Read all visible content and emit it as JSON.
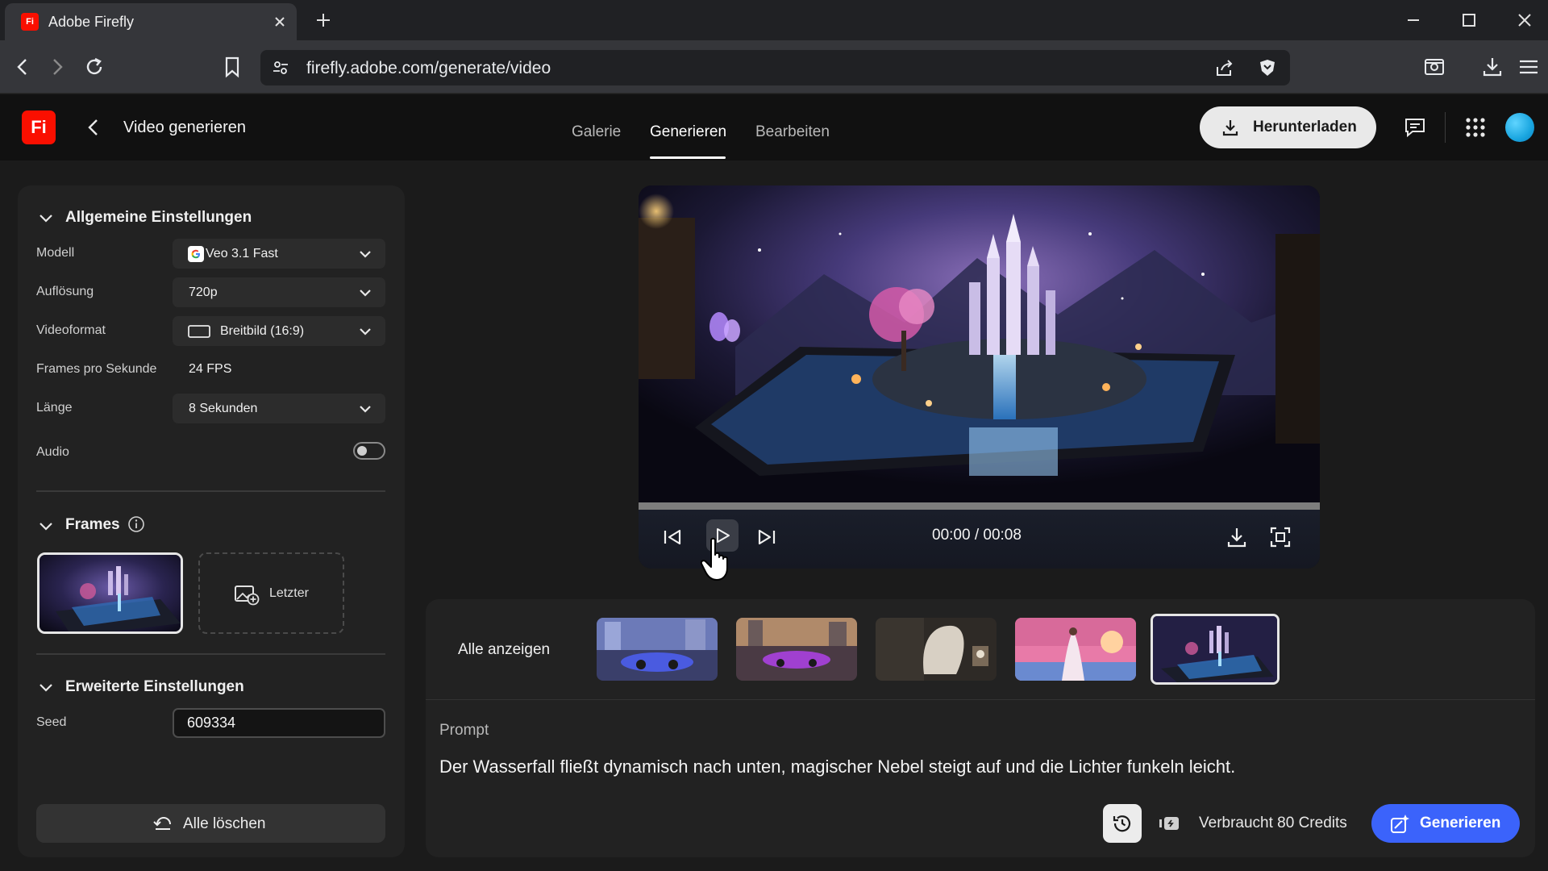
{
  "browser": {
    "tab_title": "Adobe Firefly",
    "tab_favicon_text": "Fi",
    "url": "firefly.adobe.com/generate/video"
  },
  "header": {
    "logo_text": "Fi",
    "title": "Video generieren",
    "tabs": [
      {
        "label": "Galerie",
        "active": false
      },
      {
        "label": "Generieren",
        "active": true
      },
      {
        "label": "Bearbeiten",
        "active": false
      }
    ],
    "download_label": "Herunterladen"
  },
  "settings": {
    "general_title": "Allgemeine Einstellungen",
    "rows": {
      "model": {
        "label": "Modell",
        "value": "Veo 3.1 Fast"
      },
      "resolution": {
        "label": "Auflösung",
        "value": "720p"
      },
      "format": {
        "label": "Videoformat",
        "value": "Breitbild (16:9)"
      },
      "fps": {
        "label": "Frames pro Sekunde",
        "value": "24 FPS"
      },
      "length": {
        "label": "Länge",
        "value": "8 Sekunden"
      },
      "audio": {
        "label": "Audio",
        "enabled": false
      }
    },
    "frames_title": "Frames",
    "last_frame_label": "Letzter",
    "advanced_title": "Erweiterte Einstellungen",
    "seed_label": "Seed",
    "seed_value": "609334",
    "clear_label": "Alle löschen"
  },
  "player": {
    "timecode": "00:00 / 00:08",
    "progress": 0
  },
  "gallery": {
    "show_all_label": "Alle anzeigen",
    "selected_index": 4
  },
  "prompt": {
    "label": "Prompt",
    "text": "Der Wasserfall fließt dynamisch nach unten, magischer Nebel steigt auf und die Lichter funkeln leicht.",
    "credits_label": "Verbraucht 80 Credits",
    "generate_label": "Generieren"
  },
  "colors": {
    "accent_blue": "#3b63fb",
    "adobe_red": "#fa0f00",
    "panel_bg": "#222222",
    "app_bg": "#1b1b1b"
  }
}
